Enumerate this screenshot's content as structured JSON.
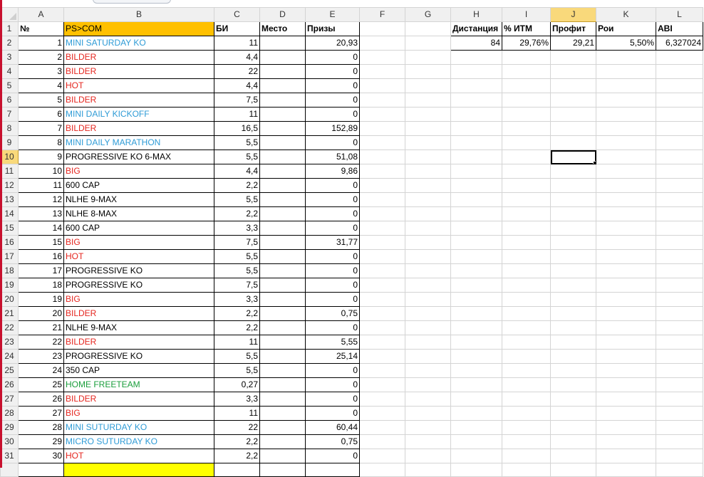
{
  "columns": [
    "A",
    "B",
    "C",
    "D",
    "E",
    "F",
    "G",
    "H",
    "I",
    "J",
    "K",
    "L"
  ],
  "active_column": "J",
  "active_row": 10,
  "header_row": {
    "A": "№",
    "B": "PS>COM",
    "C": "БИ",
    "D": "Место",
    "E": "Призы",
    "H": "Дистанция",
    "I": "% ИТМ",
    "J": "Профит",
    "K": "Рои",
    "L": "ABI"
  },
  "stats_row": {
    "H": "84",
    "I": "29,76%",
    "J": "29,21",
    "K": "5,50%",
    "L": "6,327024"
  },
  "rows": [
    {
      "row": "2",
      "num": "1",
      "name": "MINI SATURDAY KO",
      "color": "blue",
      "bi": "11",
      "prize": "20,93"
    },
    {
      "row": "3",
      "num": "2",
      "name": "BILDER",
      "color": "red",
      "bi": "4,4",
      "prize": "0"
    },
    {
      "row": "4",
      "num": "3",
      "name": "BILDER",
      "color": "red",
      "bi": "22",
      "prize": "0"
    },
    {
      "row": "5",
      "num": "4",
      "name": "HOT",
      "color": "red",
      "bi": "4,4",
      "prize": "0"
    },
    {
      "row": "6",
      "num": "5",
      "name": "BILDER",
      "color": "red",
      "bi": "7,5",
      "prize": "0"
    },
    {
      "row": "7",
      "num": "6",
      "name": "MINI DAILY KICKOFF",
      "color": "blue",
      "bi": "11",
      "prize": "0"
    },
    {
      "row": "8",
      "num": "7",
      "name": "BILDER",
      "color": "red",
      "bi": "16,5",
      "prize": "152,89"
    },
    {
      "row": "9",
      "num": "8",
      "name": "MINI DAILY MARATHON",
      "color": "blue",
      "bi": "5,5",
      "prize": "0"
    },
    {
      "row": "10",
      "num": "9",
      "name": "PROGRESSIVE KO 6-MAX",
      "color": "black",
      "bi": "5,5",
      "prize": "51,08"
    },
    {
      "row": "11",
      "num": "10",
      "name": "BIG",
      "color": "red",
      "bi": "4,4",
      "prize": "9,86"
    },
    {
      "row": "12",
      "num": "11",
      "name": "600 CAP",
      "color": "black",
      "bi": "2,2",
      "prize": "0"
    },
    {
      "row": "13",
      "num": "12",
      "name": "NLHE 9-MAX",
      "color": "black",
      "bi": "5,5",
      "prize": "0"
    },
    {
      "row": "14",
      "num": "13",
      "name": "NLHE 8-MAX",
      "color": "black",
      "bi": "2,2",
      "prize": "0"
    },
    {
      "row": "15",
      "num": "14",
      "name": "600 CAP",
      "color": "black",
      "bi": "3,3",
      "prize": "0"
    },
    {
      "row": "16",
      "num": "15",
      "name": "BIG",
      "color": "red",
      "bi": "7,5",
      "prize": "31,77"
    },
    {
      "row": "17",
      "num": "16",
      "name": "HOT",
      "color": "red",
      "bi": "5,5",
      "prize": "0"
    },
    {
      "row": "18",
      "num": "17",
      "name": "PROGRESSIVE KO",
      "color": "black",
      "bi": "5,5",
      "prize": "0"
    },
    {
      "row": "19",
      "num": "18",
      "name": "PROGRESSIVE KO",
      "color": "black",
      "bi": "7,5",
      "prize": "0"
    },
    {
      "row": "20",
      "num": "19",
      "name": "BIG",
      "color": "red",
      "bi": "3,3",
      "prize": "0"
    },
    {
      "row": "21",
      "num": "20",
      "name": "BILDER",
      "color": "red",
      "bi": "2,2",
      "prize": "0,75"
    },
    {
      "row": "22",
      "num": "21",
      "name": "NLHE 9-MAX",
      "color": "black",
      "bi": "2,2",
      "prize": "0"
    },
    {
      "row": "23",
      "num": "22",
      "name": "BILDER",
      "color": "red",
      "bi": "11",
      "prize": "5,55"
    },
    {
      "row": "24",
      "num": "23",
      "name": "PROGRESSIVE KO",
      "color": "black",
      "bi": "5,5",
      "prize": "25,14"
    },
    {
      "row": "25",
      "num": "24",
      "name": "350 CAP",
      "color": "black",
      "bi": "5,5",
      "prize": "0"
    },
    {
      "row": "26",
      "num": "25",
      "name": "HOME FREETEAM",
      "color": "green",
      "bi": "0,27",
      "prize": "0"
    },
    {
      "row": "27",
      "num": "26",
      "name": "BILDER",
      "color": "red",
      "bi": "3,3",
      "prize": "0"
    },
    {
      "row": "28",
      "num": "27",
      "name": "BIG",
      "color": "red",
      "bi": "11",
      "prize": "0"
    },
    {
      "row": "29",
      "num": "28",
      "name": "MINI SUTURDAY KO",
      "color": "blue",
      "bi": "22",
      "prize": "60,44"
    },
    {
      "row": "30",
      "num": "29",
      "name": "MICRO SUTURDAY KO",
      "color": "blue",
      "bi": "2,2",
      "prize": "0,75"
    },
    {
      "row": "31",
      "num": "30",
      "name": "HOT",
      "color": "red",
      "bi": "2,2",
      "prize": "0"
    }
  ],
  "colors": {
    "header_fill": "#ffc000",
    "bright_yellow": "#ffff00",
    "blue_text": "#2e9bd6",
    "red_text": "#e5261f",
    "green_text": "#1a9e3b",
    "active_header": "#f9d97b"
  }
}
